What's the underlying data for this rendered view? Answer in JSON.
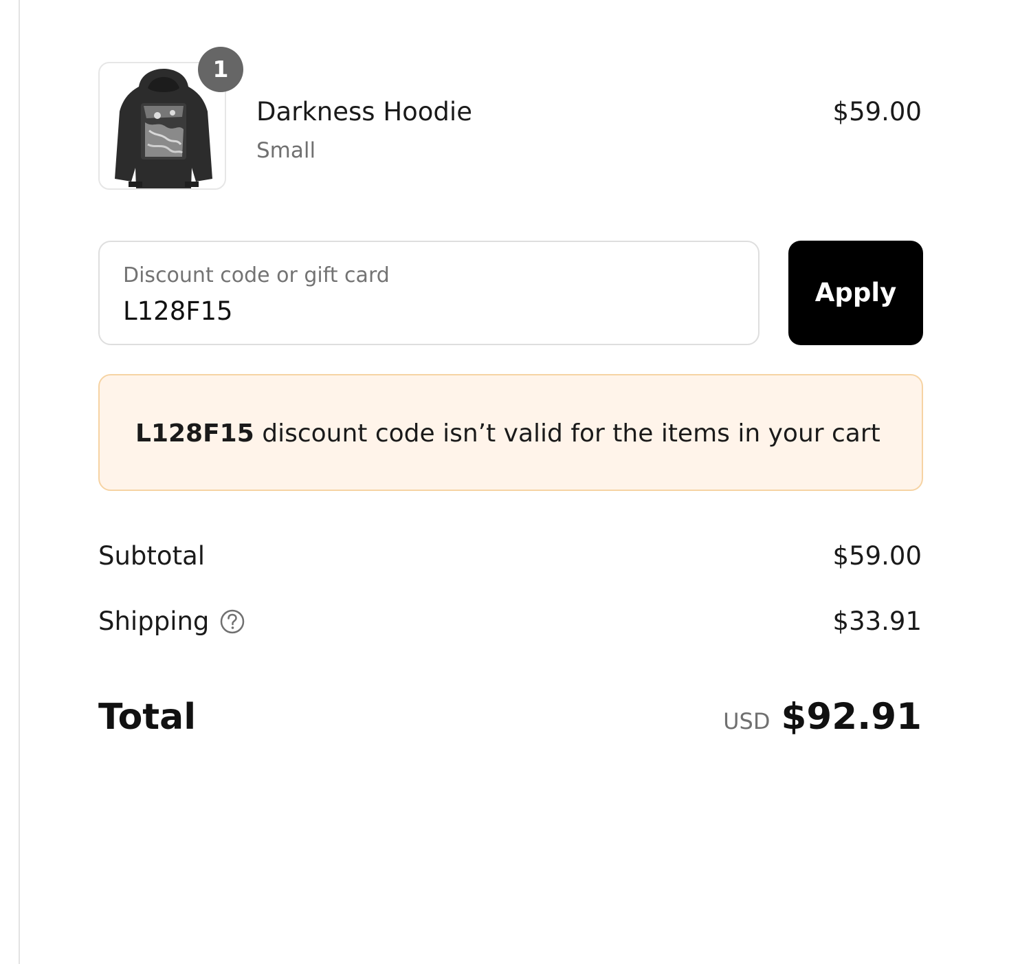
{
  "cart": {
    "items": [
      {
        "name": "Darkness Hoodie",
        "variant": "Small",
        "price": "$59.00",
        "quantity": "1"
      }
    ]
  },
  "discount": {
    "label": "Discount code or gift card",
    "value": "L128F15",
    "apply_label": "Apply"
  },
  "warning": {
    "code": "L128F15",
    "message": " discount code isn’t valid for the items in your cart",
    "background": "#fff4ea",
    "border": "#f6d3a3"
  },
  "totals": {
    "subtotal_label": "Subtotal",
    "subtotal_value": "$59.00",
    "shipping_label": "Shipping",
    "shipping_value": "$33.91",
    "total_label": "Total",
    "currency": "USD",
    "total_value": "$92.91"
  },
  "icons": {
    "shipping_help": "question-circle-icon",
    "product_image": "hoodie-icon"
  }
}
